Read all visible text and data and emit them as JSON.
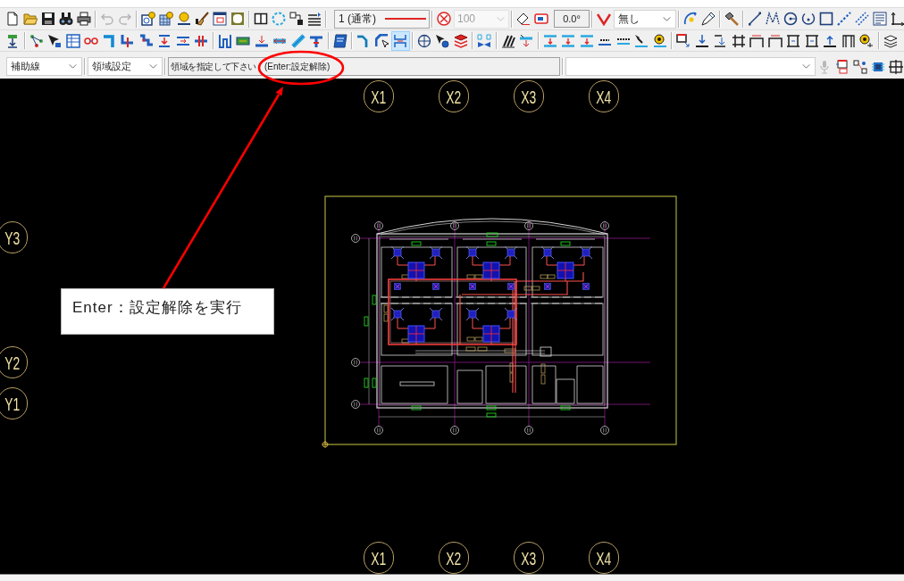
{
  "toolbar_main": {
    "undo": {
      "disabled": true
    },
    "redo": {
      "disabled": true
    },
    "line_type": {
      "value": "1 (通常)"
    },
    "scale": {
      "value": "100",
      "disabled": true
    },
    "angle": {
      "value": "0.0°"
    },
    "pattern": {
      "value": "無し"
    }
  },
  "toolbar_pipe": {
    "toggle": {
      "on": true
    }
  },
  "command_bar": {
    "layer": {
      "value": "補助線"
    },
    "mode": {
      "value": "領域設定"
    },
    "prompt": {
      "message": "領域を指定して下さい",
      "hint": "(Enter:設定解除)"
    },
    "voice_input": {
      "disabled": true
    }
  },
  "canvas": {
    "grid_top": [
      "X1",
      "X2",
      "X3",
      "X4"
    ],
    "grid_left": [
      "Y3",
      "Y2",
      "Y1"
    ],
    "grid_bottom": [
      "X1",
      "X2",
      "X3",
      "X4"
    ]
  },
  "annotation": {
    "text": "Enter：設定解除を実行"
  }
}
